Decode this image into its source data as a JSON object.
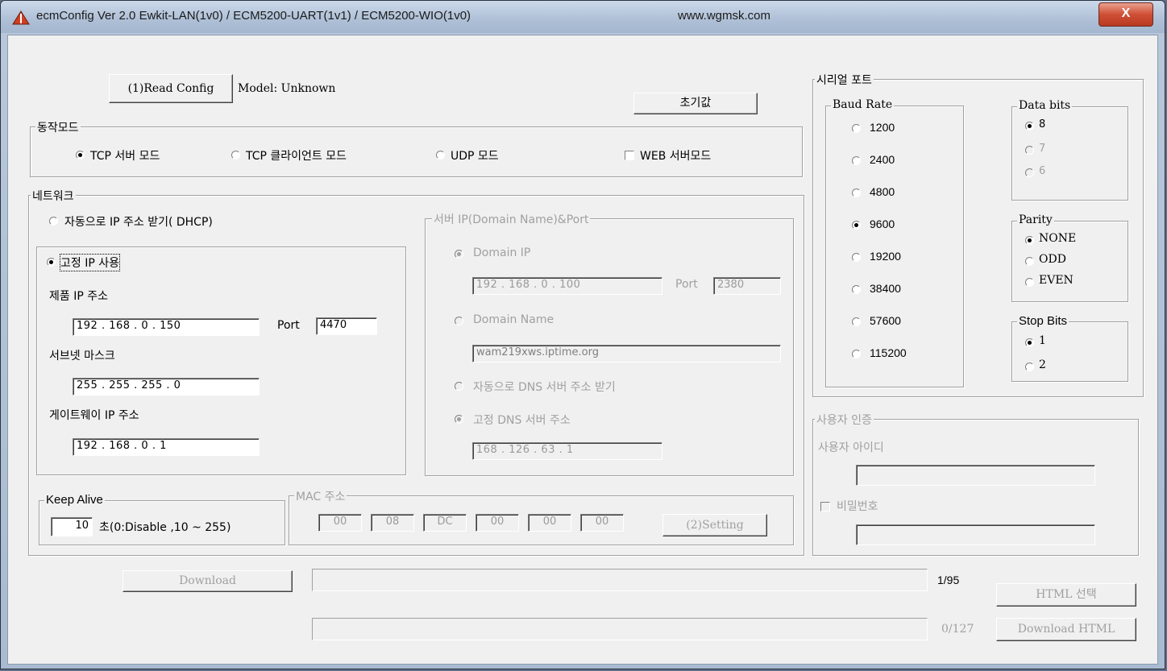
{
  "window": {
    "title": "ecmConfig Ver 2.0 Ewkit-LAN(1v0) / ECM5200-UART(1v1) / ECM5200-WIO(1v0)",
    "url": "www.wgmsk.com",
    "close_label": "X"
  },
  "top": {
    "read_config_label": "(1)Read Config",
    "model_text": "Model: Unknown",
    "reset_label": "초기값"
  },
  "mode": {
    "group_label": "동작모드",
    "tcp_server": "TCP 서버 모드",
    "tcp_client": "TCP 클라이언트 모드",
    "udp": "UDP 모드",
    "web_server": "WEB 서버모드",
    "selected": "TCP 서버 모드"
  },
  "network": {
    "group_label": "네트워크",
    "dhcp_label": "자동으로 IP 주소 받기( DHCP)",
    "static_label": "고정 IP 사용",
    "product_ip_label": "제품 IP 주소",
    "product_ip": "192 .  168 .    0  .  150",
    "port_label": "Port",
    "port": "4470",
    "subnet_label": "서브넷 마스크",
    "subnet": "255 .  255 .  255 .    0",
    "gateway_label": "게이트웨이 IP 주소",
    "gateway": "192 .  168 .    0  .    1"
  },
  "server": {
    "group_label": "서버 IP(Domain Name)&Port",
    "domain_ip_label": "Domain IP",
    "domain_ip": "192  .  168  .    0   .  100",
    "port_label": "Port",
    "port": "2380",
    "domain_name_label": "Domain Name",
    "domain_name": "wam219xws.iptime.org",
    "auto_dns_label": "자동으로 DNS 서버 주소 받기",
    "static_dns_label": "고정 DNS 서버 주소",
    "dns": "168  .  126  .   63   .    1"
  },
  "keepalive": {
    "group_label": "Keep Alive",
    "value": "10",
    "suffix": "초(0:Disable ,10 ~ 255)"
  },
  "mac": {
    "group_label": "MAC 주소",
    "octets": [
      "00",
      "08",
      "DC",
      "00",
      "00",
      "00"
    ],
    "setting_label": "(2)Setting"
  },
  "serial": {
    "group_label": "시리얼 포트",
    "baud_label": "Baud Rate",
    "baud_rates": [
      "1200",
      "2400",
      "4800",
      "9600",
      "19200",
      "38400",
      "57600",
      "115200"
    ],
    "baud_selected": "9600",
    "data_bits_label": "Data bits",
    "data_bits": [
      "8",
      "7",
      "6"
    ],
    "data_bits_selected": "8",
    "parity_label": "Parity",
    "parity": [
      "NONE",
      "ODD",
      "EVEN"
    ],
    "parity_selected": "NONE",
    "stop_bits_label": "Stop Bits",
    "stop_bits": [
      "1",
      "2"
    ],
    "stop_bits_selected": "1"
  },
  "auth": {
    "group_label": "사용자 인증",
    "user_id_label": "사용자 아이디",
    "user_id": "",
    "password_label": "비밀번호",
    "password": ""
  },
  "download": {
    "download_label": "Download",
    "count1": "1/95",
    "html_select_label": "HTML 선택",
    "count2": "0/127",
    "download_html_label": "Download HTML"
  }
}
